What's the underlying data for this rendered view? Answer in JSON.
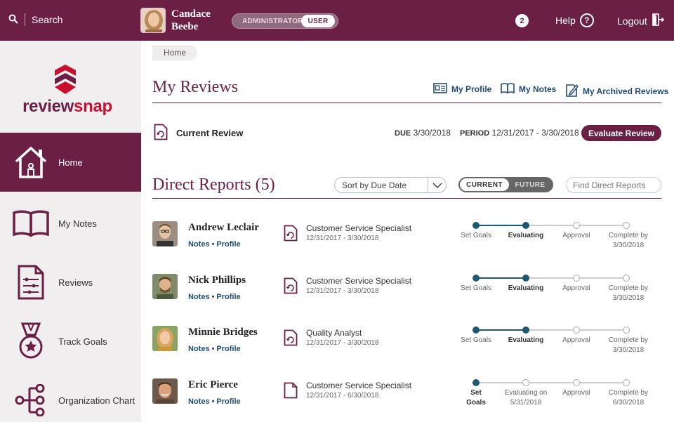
{
  "topbar": {
    "search_label": "Search",
    "user_first": "Candace",
    "user_last": "Beebe",
    "role_admin": "ADMINISTRATOR",
    "role_user": "USER",
    "notification_count": "2",
    "help_label": "Help",
    "logout_label": "Logout"
  },
  "logo": {
    "part1": "review",
    "part2": "snap"
  },
  "sidebar": {
    "items": [
      {
        "label": "Home",
        "icon": "house-icon"
      },
      {
        "label": "My Notes",
        "icon": "book-icon"
      },
      {
        "label": "Reviews",
        "icon": "checklist-document-icon"
      },
      {
        "label": "Track Goals",
        "icon": "medal-icon"
      },
      {
        "label": "Organization Chart",
        "icon": "org-chart-icon"
      }
    ]
  },
  "breadcrumb": {
    "home": "Home"
  },
  "my_reviews": {
    "title": "My Reviews",
    "links": {
      "profile": "My Profile",
      "notes": "My Notes",
      "archived": "My Archived Reviews"
    },
    "current_label": "Current Review",
    "due_label": "DUE",
    "due_value": "3/30/2018",
    "period_label": "PERIOD",
    "period_value": "12/31/2017 - 3/30/2018",
    "evaluate_button": "Evaluate Review"
  },
  "direct_reports": {
    "title": "Direct Reports (5)",
    "sort_value": "Sort by Due Date",
    "seg_current": "CURRENT",
    "seg_future": "FUTURE",
    "find_placeholder": "Find Direct Reports",
    "notes_link": "Notes",
    "profile_link": "Profile",
    "reports": [
      {
        "name": "Andrew Leclair",
        "job": "Customer Service Specialist",
        "dates": "12/31/2017 - 3/30/2018",
        "stage_labels": [
          "Set Goals",
          "Evaluating",
          "Approval",
          "Complete by",
          "3/30/2018"
        ],
        "current_stage": 1
      },
      {
        "name": "Nick Phillips",
        "job": "Customer Service Specialist",
        "dates": "12/31/2017 - 3/30/2018",
        "stage_labels": [
          "Set Goals",
          "Evaluating",
          "Approval",
          "Complete by",
          "3/30/2018"
        ],
        "current_stage": 1
      },
      {
        "name": "Minnie Bridges",
        "job": "Quality Analyst",
        "dates": "12/31/2017 - 3/30/2018",
        "stage_labels": [
          "Set Goals",
          "Evaluating",
          "Approval",
          "Complete by",
          "3/30/2018"
        ],
        "current_stage": 1
      },
      {
        "name": "Eric Pierce",
        "job": "Customer Service Specialist",
        "dates": "12/31/2017 - 6/30/2018",
        "stage_labels": [
          "Set Goals",
          "Evaluating on",
          "Approval",
          "Complete by",
          "6/30/2018"
        ],
        "stage_sub": "5/31/2018",
        "current_stage": 0
      }
    ]
  },
  "colors": {
    "brand": "#6b1f45",
    "link": "#1f4b73",
    "progress": "#1f5873"
  }
}
